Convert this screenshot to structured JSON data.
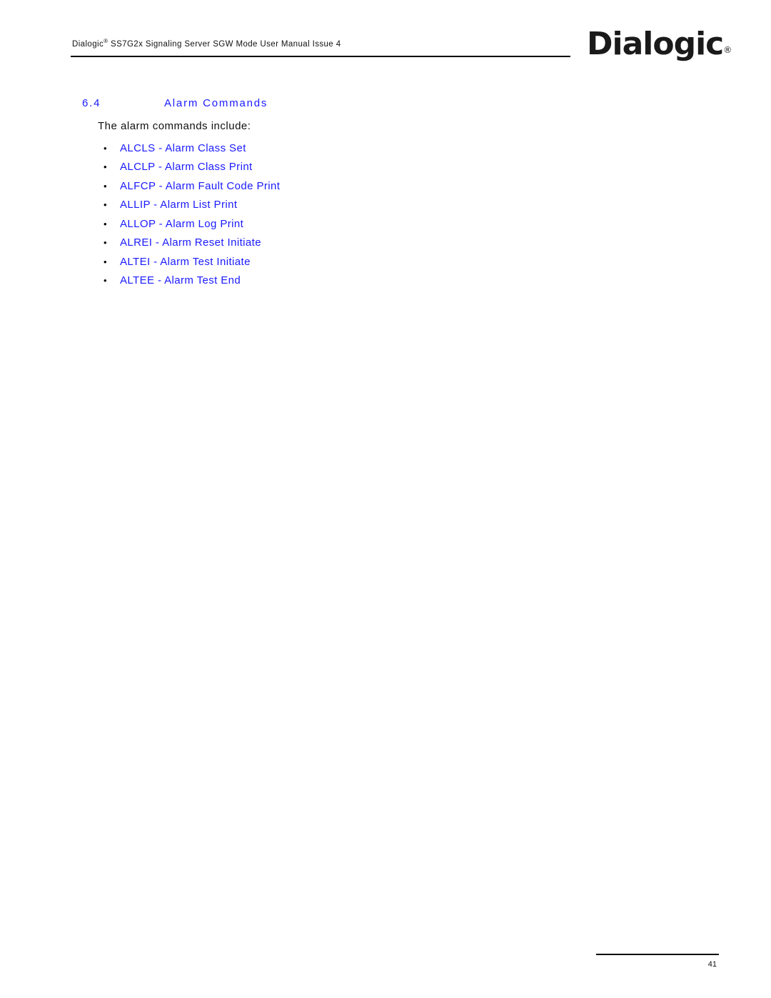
{
  "header": {
    "brand": "Dialogic",
    "registered_mark": "®",
    "title_rest": " SS7G2x Signaling Server SGW Mode User Manual  Issue 4",
    "logo_text": "Dialogic",
    "logo_mark": "®"
  },
  "section": {
    "number": "6.4",
    "title": "Alarm Commands",
    "intro": "The alarm commands include:",
    "bullet_glyph": "•",
    "commands": [
      {
        "code": "ALCLS",
        "separator": " - ",
        "description": "Alarm Class Set"
      },
      {
        "code": "ALCLP",
        "separator": " - ",
        "description": "Alarm Class Print"
      },
      {
        "code": "ALFCP",
        "separator": " - ",
        "description": "Alarm Fault Code Print"
      },
      {
        "code": "ALLIP",
        "separator": " - ",
        "description": "Alarm List Print"
      },
      {
        "code": "ALLOP",
        "separator": " - ",
        "description": "Alarm Log Print"
      },
      {
        "code": "ALREI",
        "separator": " - ",
        "description": "Alarm Reset Initiate"
      },
      {
        "code": "ALTEI",
        "separator": " - ",
        "description": "Alarm Test Initiate"
      },
      {
        "code": "ALTEE",
        "separator": " - ",
        "description": "Alarm Test End"
      }
    ]
  },
  "footer": {
    "page_number": "41"
  },
  "colors": {
    "link": "#1a1aff",
    "text": "#111111"
  }
}
